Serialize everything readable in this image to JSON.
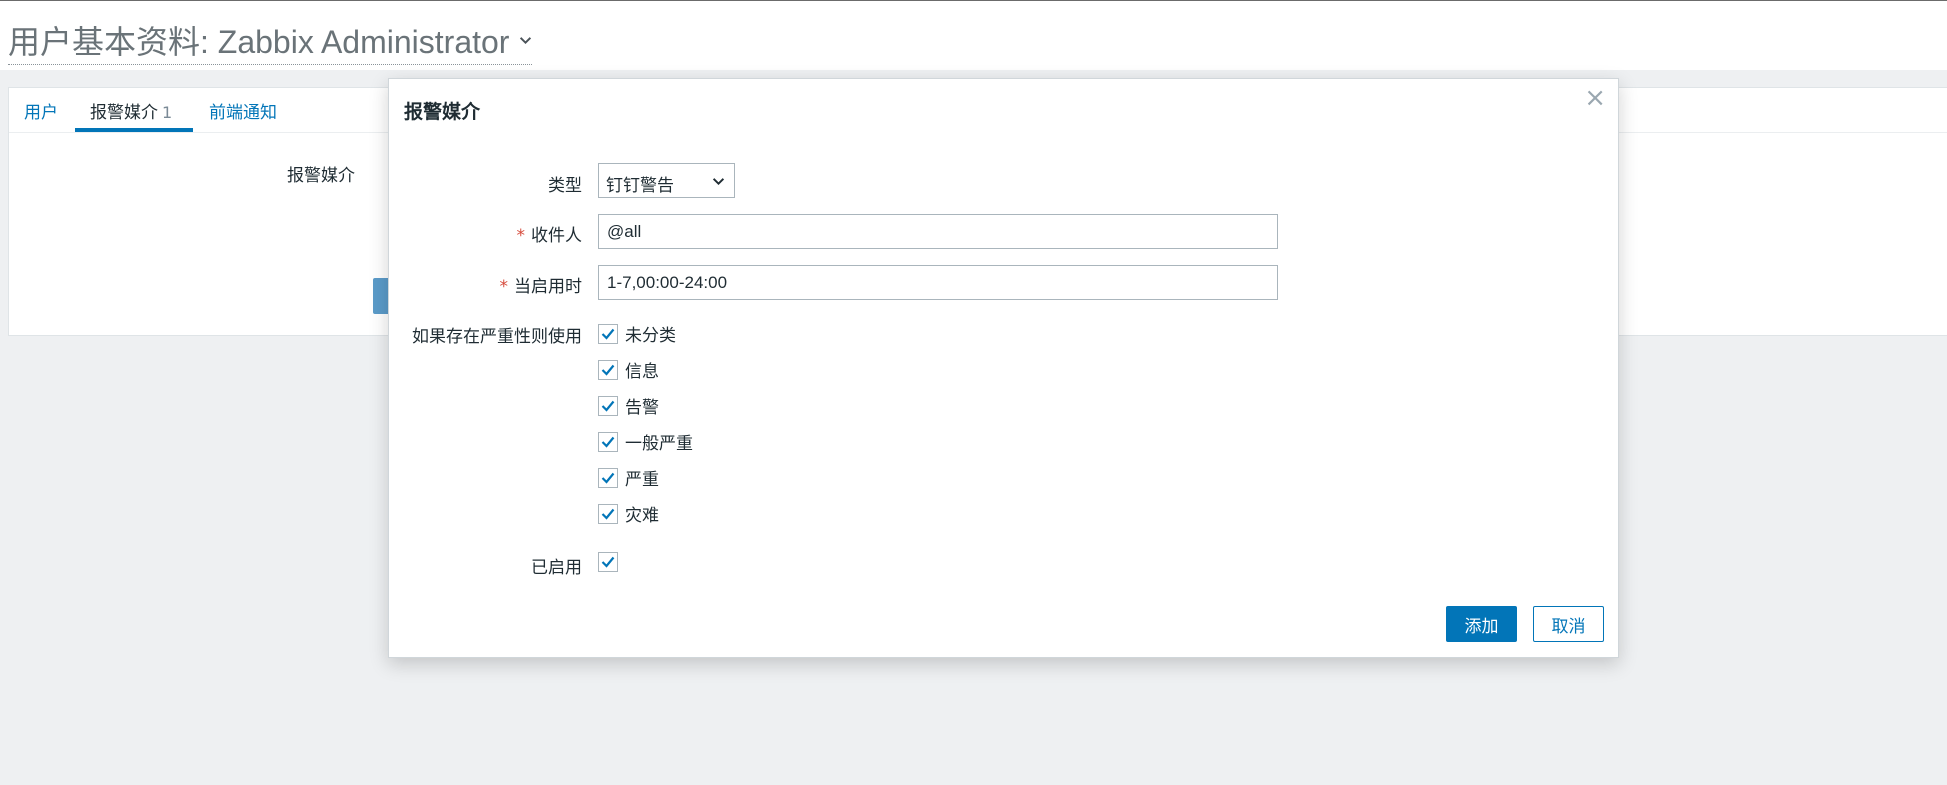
{
  "header": {
    "title": "用户基本资料: Zabbix Administrator"
  },
  "tabs": [
    {
      "label": "用户",
      "count": ""
    },
    {
      "label": "报警媒介",
      "count": "1"
    },
    {
      "label": "前端通知",
      "count": ""
    }
  ],
  "background": {
    "media_label": "报警媒介"
  },
  "dialog": {
    "title": "报警媒介",
    "close_symbol": "×",
    "type": {
      "label": "类型",
      "selected": "钉钉警告"
    },
    "sendto": {
      "required_mark": "*",
      "label": "收件人",
      "value": "@all"
    },
    "period": {
      "required_mark": "*",
      "label": "当启用时",
      "value": "1-7,00:00-24:00"
    },
    "severity": {
      "label": "如果存在严重性则使用",
      "options": [
        {
          "label": "未分类",
          "checked": true
        },
        {
          "label": "信息",
          "checked": true
        },
        {
          "label": "告警",
          "checked": true
        },
        {
          "label": "一般严重",
          "checked": true
        },
        {
          "label": "严重",
          "checked": true
        },
        {
          "label": "灾难",
          "checked": true
        }
      ]
    },
    "enabled": {
      "label": "已启用",
      "checked": true
    },
    "buttons": {
      "add": "添加",
      "cancel": "取消"
    }
  },
  "colors": {
    "accent": "#0275b8",
    "required": "#d64b3c",
    "page_bg": "#eef0f2"
  },
  "icons": {
    "title_dropdown": "chevron-down-icon",
    "select_dropdown": "chevron-down-icon",
    "close": "close-icon",
    "checkbox": "check-icon"
  }
}
